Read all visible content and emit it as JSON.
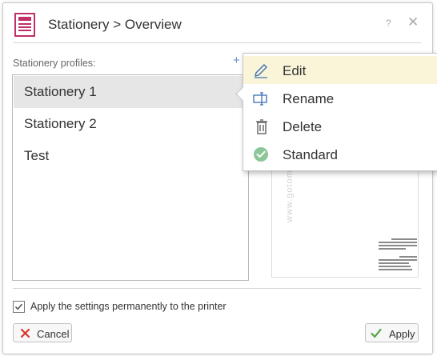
{
  "window": {
    "title": "Stationery > Overview",
    "help_label": "?",
    "close_label": "✕"
  },
  "profiles": {
    "label": "Stationery profiles:",
    "add_label": "+",
    "items": [
      {
        "label": "Stationery 1",
        "selected": true
      },
      {
        "label": "Stationery 2",
        "selected": false
      },
      {
        "label": "Test",
        "selected": false
      }
    ]
  },
  "context_menu": {
    "items": [
      {
        "label": "Edit",
        "icon": "pencil-icon",
        "active": true
      },
      {
        "label": "Rename",
        "icon": "rename-icon",
        "active": false
      },
      {
        "label": "Delete",
        "icon": "trash-icon",
        "active": false
      },
      {
        "label": "Standard",
        "icon": "check-circle-icon",
        "active": false
      }
    ]
  },
  "preview": {
    "watermark": "www.gotomaxx.com"
  },
  "footer": {
    "apply_permanently_label": "Apply the settings permanently to the printer",
    "apply_permanently_checked": true,
    "cancel_label": "Cancel",
    "apply_label": "Apply"
  },
  "colors": {
    "accent_pink": "#c0306a",
    "menu_highlight": "#faf5d8",
    "cancel_red": "#d9342b",
    "apply_green": "#5aa64a",
    "standard_green": "#8cc79a"
  }
}
